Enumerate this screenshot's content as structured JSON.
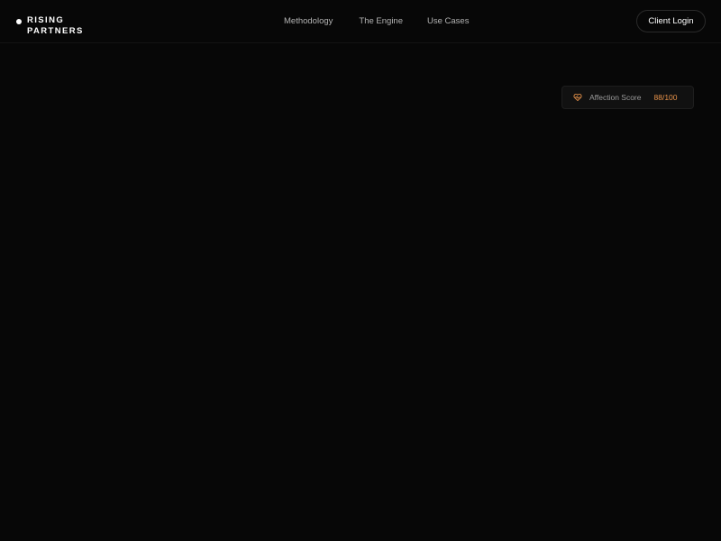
{
  "brand": {
    "line1": "RISING",
    "line2": "PARTNERS"
  },
  "nav": {
    "items": [
      {
        "label": "Methodology"
      },
      {
        "label": "The Engine"
      },
      {
        "label": "Use Cases"
      }
    ],
    "login_label": "Client Login"
  },
  "score_card": {
    "icon": "heart-pulse-icon",
    "label": "Affection Score",
    "value": "88/100"
  },
  "colors": {
    "background": "#070707",
    "accent": "#e7924a",
    "text": "#ffffff",
    "muted": "#b3b3b3"
  }
}
